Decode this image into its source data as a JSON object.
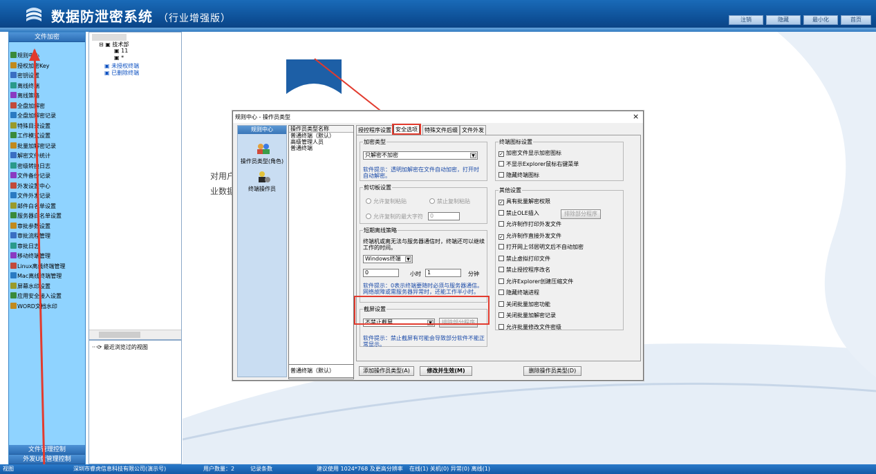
{
  "app": {
    "title": "数据防泄密系统",
    "edition": "（行业增强版）",
    "topbar_buttons": [
      "注销",
      "隐藏",
      "最小化",
      "首页"
    ]
  },
  "left_panel": {
    "header": "文件加密",
    "items": [
      "规则中心",
      "授权加密Key",
      "密钥设置",
      "离线终端",
      "离线策略",
      "全盘加解密",
      "全盘加解密记录",
      "特殊目录设置",
      "工作模式设置",
      "批量加解密记录",
      "解密文件统计",
      "密级转换日志",
      "文件备份记录",
      "外发设置中心",
      "文件外发记录",
      "邮件白名单设置",
      "服务器白名单设置",
      "审批参数设置",
      "审批流程管理",
      "审批日志",
      "移动终端管理",
      "Linux离线终端管理",
      "Mac离线终端管理",
      "屏幕水印设置",
      "应用安全接入设置",
      "WORD文档水印"
    ],
    "footer_buttons": [
      "文件管理控制",
      "外发U盘管理控制"
    ]
  },
  "tree": {
    "root_label": "",
    "items": [
      "技术部",
      "11",
      "*",
      "未授权终端",
      "已删除终端"
    ],
    "recent_label": "最近浏览过的视图"
  },
  "main_bg_text": [
    "对用户",
    "业数据"
  ],
  "dialog": {
    "title": "规则中心 - 操作员类型",
    "close": "×",
    "nav_header": "规则中心",
    "nav_items": [
      "操作员类型(角色)",
      "终端操作员"
    ],
    "list_header": "操作员类型名称",
    "list_items": [
      "普通终端（默认）",
      "高级管理人员",
      "普通终端"
    ],
    "list_footer": "普通终端（默认）",
    "tabs": [
      "授控程序设置",
      "安全选项",
      "特殊文件后缀",
      "文件外发"
    ],
    "encrypt_type": {
      "legend": "加密类型",
      "value": "只解密不加密",
      "tip": "软件提示：透明加解密在文件自动加密，打开时自动解密。"
    },
    "clipboard": {
      "legend": "剪切板设置",
      "opt1": "允许复制粘贴",
      "opt2": "禁止复制粘贴",
      "opt3": "允许复制的最大字符",
      "max_chars": "0"
    },
    "offline": {
      "legend": "短期离线策略",
      "desc": "终端机或离无法与服务器通信时，终端还可以继续工作的时间。",
      "os": "Windows终端",
      "hours": "0",
      "hours_unit": "小时",
      "minutes": "1",
      "minutes_unit": "分钟",
      "tip": "软件提示：0表示终端要随时必须与服务器通信。网络故障或需服务器异常时，还能工作半小时。"
    },
    "screenshot": {
      "legend": "截屏设置",
      "value": "不禁止截屏",
      "exclude_btn": "排除部分程序",
      "tip": "软件提示：禁止截屏有可能会导致部分软件不能正常显示。"
    },
    "terminal_icon": {
      "legend": "终端图标设置",
      "items": [
        {
          "label": "加密文件显示加密图标",
          "checked": true
        },
        {
          "label": "不显示Explorer鼠标右键菜单",
          "checked": false
        },
        {
          "label": "隐藏终端图标",
          "checked": false
        }
      ]
    },
    "other": {
      "legend": "其他设置",
      "ole_btn": "排除部分程序",
      "items": [
        {
          "label": "具有批量解密权限",
          "checked": true
        },
        {
          "label": "禁止OLE插入",
          "checked": false
        },
        {
          "label": "允许制作打印外发文件",
          "checked": false
        },
        {
          "label": "允许制作直接外发文件",
          "checked": true
        },
        {
          "label": "打开网上邻居明文后不自动加密",
          "checked": false
        },
        {
          "label": "禁止虚拟打印文件",
          "checked": false
        },
        {
          "label": "禁止授控程序改名",
          "checked": false
        },
        {
          "label": "允许Explorer创建压缩文件",
          "checked": false
        },
        {
          "label": "隐藏终端进程",
          "checked": false
        },
        {
          "label": "关闭批量加密功能",
          "checked": false
        },
        {
          "label": "关闭批量加解密记录",
          "checked": false
        },
        {
          "label": "允许批量修改文件密级",
          "checked": false
        }
      ]
    },
    "buttons": {
      "add": "添加操作员类型(A)",
      "apply": "修改并生效(M)",
      "delete": "删除操作员类型(D)"
    }
  },
  "statusbar": [
    "视图",
    "深圳市睿虎信息科技有限公司(演示号)",
    "用户数量：2",
    "记录条数",
    "建议使用 1024*768 及更高分辨率",
    "在线(1) 关机(0) 异常(0) 离线(1)"
  ]
}
